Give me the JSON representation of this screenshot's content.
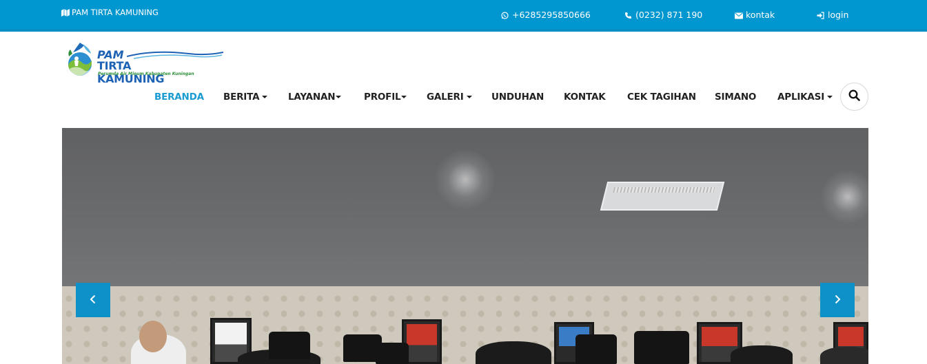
{
  "topbar": {
    "brand": "PAM TIRTA KAMUNING",
    "whatsapp": "+6285295850666",
    "phone": "(0232) 871 190",
    "contact": "kontak",
    "login": "login"
  },
  "logo": {
    "line1": "PAM",
    "line2": "TIRTA KAMUNING",
    "tagline": "Perumda Air Minum Kabupaten Kuningan"
  },
  "nav": {
    "items": [
      {
        "label": "BERANDA",
        "active": true,
        "dropdown": false
      },
      {
        "label": "BERITA",
        "dropdown": true
      },
      {
        "label": "LAYANAN",
        "dropdown": true
      },
      {
        "label": "PROFIL",
        "dropdown": true
      },
      {
        "label": "GALERI",
        "dropdown": true
      },
      {
        "label": "UNDUHAN",
        "dropdown": false
      },
      {
        "label": "KONTAK",
        "dropdown": false
      },
      {
        "label": "CEK TAGIHAN",
        "dropdown": false
      },
      {
        "label": "SIMANO",
        "dropdown": false
      },
      {
        "label": "APLIKASI",
        "dropdown": true
      }
    ]
  },
  "icons": {
    "brand": "map-icon",
    "whatsapp": "whatsapp-icon",
    "phone": "phone-icon",
    "contact": "envelope-icon",
    "login": "sign-in-icon",
    "search": "search-icon",
    "prev": "chevron-left-icon",
    "next": "chevron-right-icon"
  },
  "colors": {
    "topbar": "#0096cf",
    "accent": "#1a9bd1",
    "arrow": "#0e90c8",
    "nav_text": "#222222"
  }
}
